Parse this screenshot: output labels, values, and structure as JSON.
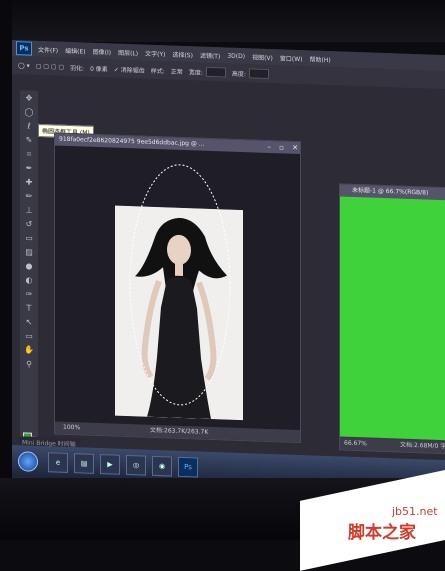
{
  "app": {
    "logo": "Ps"
  },
  "menu": [
    "文件(F)",
    "编辑(E)",
    "图像(I)",
    "图层(L)",
    "文字(Y)",
    "选择(S)",
    "滤镜(T)",
    "3D(D)",
    "视图(V)",
    "窗口(W)",
    "帮助(H)"
  ],
  "options": {
    "feather_label": "羽化:",
    "feather_value": "0 像素",
    "antialias_label": "消除锯齿",
    "style_label": "样式:",
    "style_value": "正常",
    "width_label": "宽度:",
    "height_label": "高度:"
  },
  "tooltip": "椭圆选框工具 (M)",
  "document": {
    "title": "918fa0ecf2e8620824975 9ee5d6ddbac.jpg @ ...",
    "zoom": "100%",
    "status": "文档:263.7K/263.7K"
  },
  "green_document": {
    "title": "未标题-1 @ 66.7%(RGB/8)",
    "zoom": "66.67%",
    "status": "文档:2.68M/0 字节"
  },
  "mini_bridge": "Mini Bridge  时间轴",
  "taskbar": {
    "ps_label": "Ps"
  },
  "watermark": {
    "line1": "jb51.net",
    "line2": "脚本之家"
  },
  "colors": {
    "foreground": "#2fa62f",
    "background": "#ffffff",
    "canvas_green": "#3fd23a"
  }
}
